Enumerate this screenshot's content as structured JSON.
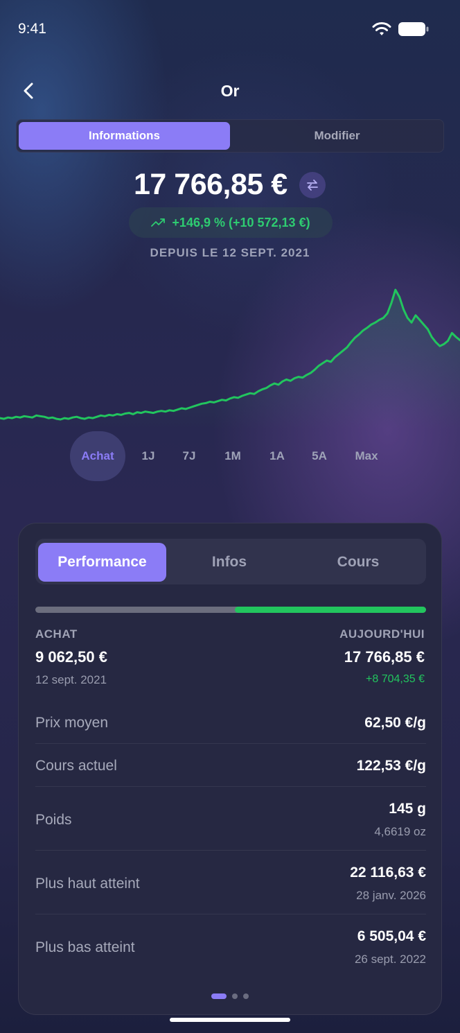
{
  "status_bar": {
    "time": "9:41"
  },
  "nav": {
    "title": "Or"
  },
  "top_tabs": {
    "active": "Informations",
    "inactive": "Modifier"
  },
  "summary": {
    "total_value": "17 766,85 €",
    "change": "+146,9 % (+10 572,13 €)",
    "since": "DEPUIS LE 12 SEPT. 2021"
  },
  "chart_data": {
    "type": "line",
    "series": [
      {
        "color": "#22c55e",
        "values": [
          62,
          61,
          63,
          62,
          64,
          63,
          65,
          64,
          63,
          66,
          65,
          64,
          62,
          63,
          61,
          60,
          62,
          61,
          63,
          64,
          62,
          61,
          63,
          62,
          64,
          66,
          65,
          67,
          66,
          68,
          67,
          69,
          70,
          68,
          71,
          70,
          72,
          71,
          70,
          72,
          73,
          72,
          74,
          73,
          75,
          77,
          76,
          78,
          80,
          82,
          84,
          85,
          87,
          86,
          88,
          90,
          89,
          92,
          94,
          93,
          96,
          98,
          100,
          99,
          103,
          106,
          108,
          112,
          115,
          113,
          118,
          121,
          119,
          123,
          125,
          124,
          128,
          131,
          136,
          142,
          146,
          150,
          148,
          155,
          160,
          165,
          170,
          178,
          185,
          190,
          196,
          200,
          205,
          208,
          212,
          215,
          222,
          238,
          258,
          247,
          228,
          215,
          208,
          219,
          212,
          205,
          198,
          186,
          178,
          172,
          175,
          180,
          192,
          186,
          181
        ]
      }
    ]
  },
  "ranges": [
    "Achat",
    "1J",
    "7J",
    "1M",
    "1A",
    "5A",
    "Max"
  ],
  "card": {
    "tabs": [
      "Performance",
      "Infos",
      "Cours"
    ],
    "progress_ratio": 0.49,
    "achat": {
      "label": "ACHAT",
      "value": "9 062,50 €",
      "date": "12 sept. 2021"
    },
    "today": {
      "label": "AUJOURD'HUI",
      "value": "17 766,85 €",
      "gain": "+8 704,35 €"
    },
    "rows": [
      {
        "label": "Prix moyen",
        "value": "62,50 €/g"
      },
      {
        "label": "Cours actuel",
        "value": "122,53 €/g"
      },
      {
        "label": "Poids",
        "value": "145 g",
        "sub": "4,6619 oz"
      },
      {
        "label": "Plus haut atteint",
        "value": "22 116,63 €",
        "sub": "28 janv. 2026"
      },
      {
        "label": "Plus bas atteint",
        "value": "6 505,04 €",
        "sub": "26 sept. 2022"
      }
    ]
  },
  "colors": {
    "accent": "#8b7cf6",
    "positive": "#22c55e"
  }
}
